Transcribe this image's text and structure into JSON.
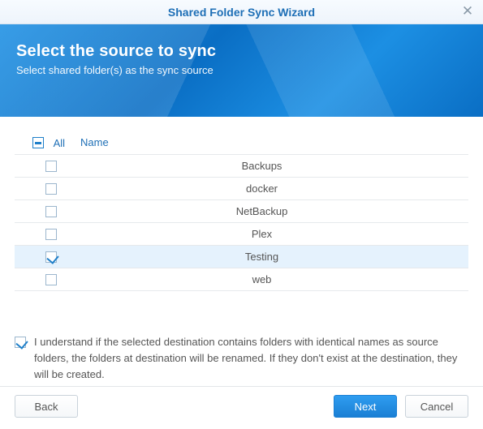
{
  "titlebar": {
    "title": "Shared Folder Sync Wizard"
  },
  "banner": {
    "heading": "Select the source to sync",
    "sub": "Select shared folder(s) as the sync source"
  },
  "table": {
    "headers": {
      "all": "All",
      "name": "Name"
    },
    "headerState": "indeterminate",
    "rows": [
      {
        "name": "Backups",
        "checked": false,
        "selected": false
      },
      {
        "name": "docker",
        "checked": false,
        "selected": false
      },
      {
        "name": "NetBackup",
        "checked": false,
        "selected": false
      },
      {
        "name": "Plex",
        "checked": false,
        "selected": false
      },
      {
        "name": "Testing",
        "checked": true,
        "selected": true
      },
      {
        "name": "web",
        "checked": false,
        "selected": false
      }
    ]
  },
  "ack": {
    "checked": true,
    "text": "I understand if the selected destination contains folders with identical names as source folders, the folders at destination will be renamed. If they don't exist at the destination, they will be created."
  },
  "buttons": {
    "back": "Back",
    "next": "Next",
    "cancel": "Cancel"
  }
}
